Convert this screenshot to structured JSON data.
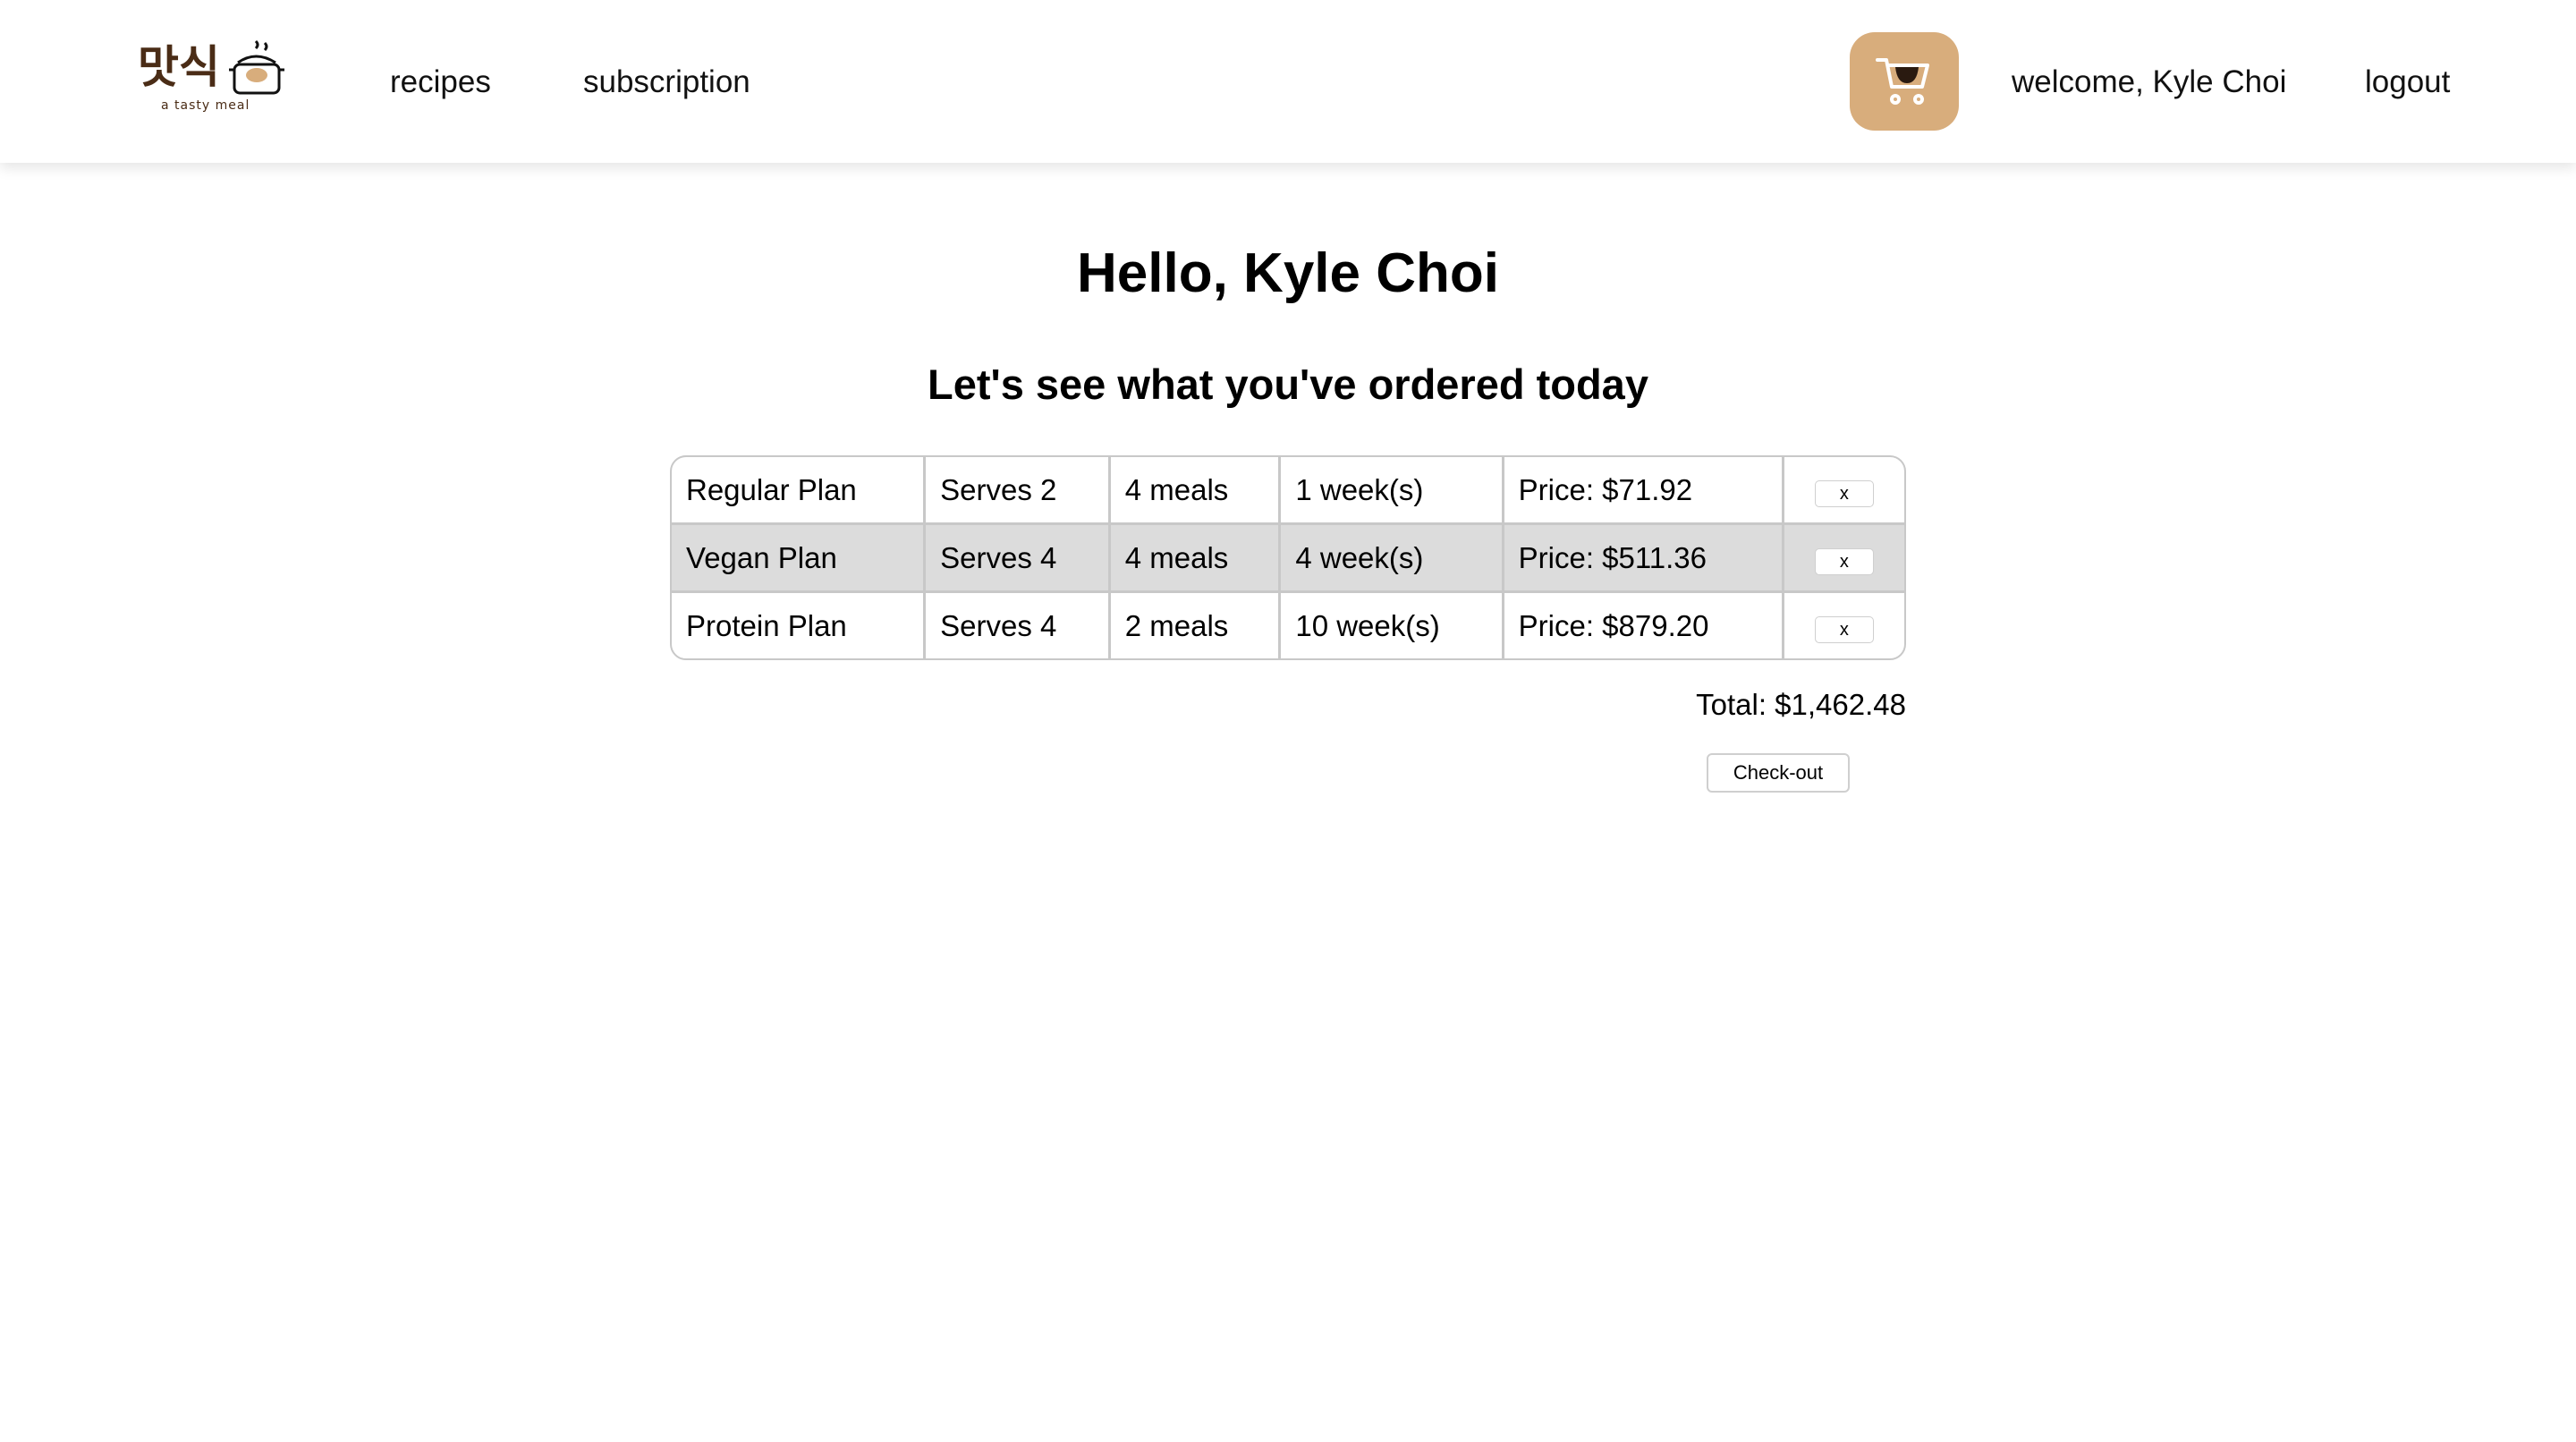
{
  "header": {
    "logo": {
      "korean_text": "맛식",
      "tagline": "a tasty meal"
    },
    "nav": [
      {
        "label": "recipes"
      },
      {
        "label": "subscription"
      }
    ],
    "cart_icon": "shopping-cart-icon",
    "welcome_text": "welcome, Kyle Choi",
    "logout_label": "logout",
    "colors": {
      "cart_bg": "#d8ad7c",
      "logo_brown": "#4a2c16"
    }
  },
  "main": {
    "title": "Hello, Kyle Choi",
    "subtitle": "Let's see what you've ordered today",
    "orders": [
      {
        "plan": "Regular Plan",
        "serves": "Serves 2",
        "meals": "4 meals",
        "weeks": "1 week(s)",
        "price": "Price: $71.92",
        "remove_label": "x"
      },
      {
        "plan": "Vegan Plan",
        "serves": "Serves 4",
        "meals": "4 meals",
        "weeks": "4 week(s)",
        "price": "Price: $511.36",
        "remove_label": "x"
      },
      {
        "plan": "Protein Plan",
        "serves": "Serves 4",
        "meals": "2 meals",
        "weeks": "10 week(s)",
        "price": "Price: $879.20",
        "remove_label": "x"
      }
    ],
    "total": "Total: $1,462.48",
    "checkout_label": "Check-out"
  }
}
